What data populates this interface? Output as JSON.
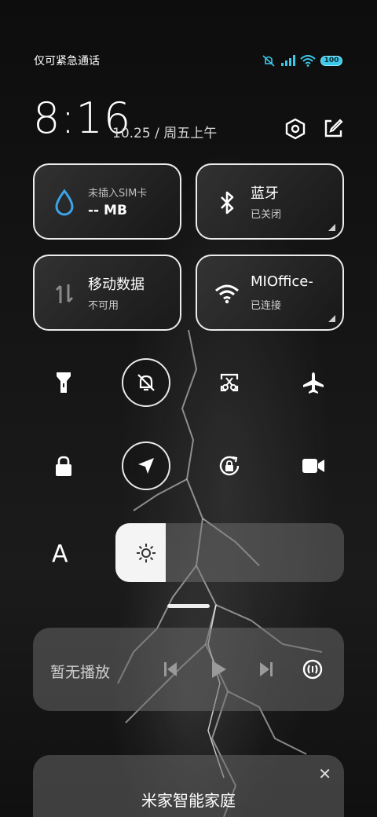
{
  "status_bar": {
    "carrier": "仅可紧急通话",
    "battery": "100",
    "accent_color": "#3cc8e8"
  },
  "header": {
    "time": "8:16",
    "date": "10.25 / 周五上午",
    "icons": [
      "settings-hexagon-icon",
      "edit-icon"
    ]
  },
  "tiles": [
    {
      "title": "未插入SIM卡",
      "subtitle": "-- MB",
      "icon": "water-drop-icon"
    },
    {
      "title": "蓝牙",
      "subtitle": "已关闭",
      "icon": "bluetooth-icon"
    },
    {
      "title": "移动数据",
      "subtitle": "不可用",
      "icon": "mobile-data-icon"
    },
    {
      "title": "MIOffice-",
      "subtitle": "已连接",
      "icon": "wifi-icon"
    }
  ],
  "toggles": [
    {
      "icon": "flashlight-icon",
      "active": false
    },
    {
      "icon": "mute-bell-icon",
      "active": true
    },
    {
      "icon": "screenshot-icon",
      "active": false
    },
    {
      "icon": "airplane-icon",
      "active": false
    },
    {
      "icon": "lock-icon",
      "active": false
    },
    {
      "icon": "location-icon",
      "active": true
    },
    {
      "icon": "rotation-lock-icon",
      "active": false
    },
    {
      "icon": "video-camera-icon",
      "active": false
    }
  ],
  "brightness": {
    "label": "A",
    "level_percent": 22
  },
  "media": {
    "title": "暂无播放",
    "controls": [
      "previous-icon",
      "play-icon",
      "next-icon",
      "cast-icon"
    ]
  },
  "smart_home": {
    "title": "米家智能家庭",
    "close": "✕"
  }
}
